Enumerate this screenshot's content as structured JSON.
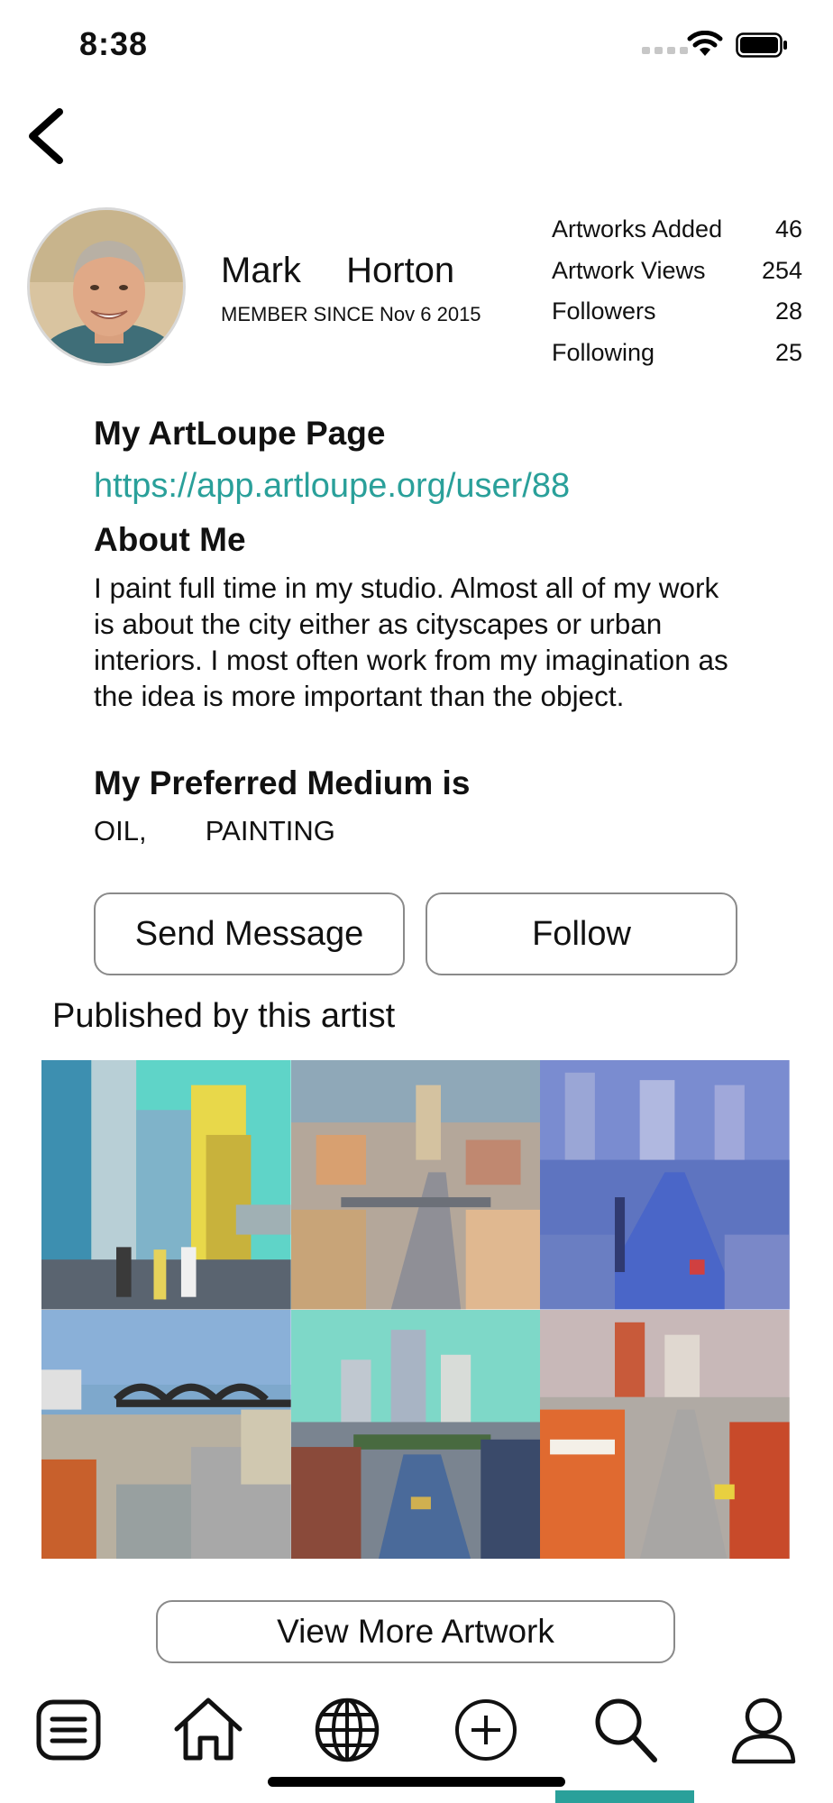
{
  "status_bar": {
    "time": "8:38"
  },
  "profile": {
    "first_name": "Mark",
    "last_name": "Horton",
    "full_name": "Mark  Horton",
    "member_since": "MEMBER SINCE Nov 6 2015"
  },
  "stats": [
    {
      "label": "Artworks Added",
      "value": "46"
    },
    {
      "label": "Artwork Views",
      "value": "254"
    },
    {
      "label": "Followers",
      "value": "28"
    },
    {
      "label": "Following",
      "value": "25"
    }
  ],
  "page_section": {
    "title": "My ArtLoupe Page",
    "url": "https://app.artloupe.org/user/88"
  },
  "about": {
    "title": "About Me",
    "text": "I paint full time in my studio. Almost all of my work is about the city either as cityscapes or urban interiors. I most often work from my imagination as the idea is more important than the object."
  },
  "medium": {
    "title": "My Preferred Medium is",
    "value": "OIL,  PAINTING"
  },
  "actions": {
    "send_message": "Send Message",
    "follow": "Follow"
  },
  "gallery": {
    "title": "Published by this artist",
    "artworks": [
      {
        "name": "artwork-1"
      },
      {
        "name": "artwork-2"
      },
      {
        "name": "artwork-3"
      },
      {
        "name": "artwork-4"
      },
      {
        "name": "artwork-5"
      },
      {
        "name": "artwork-6"
      }
    ],
    "view_more": "View More Artwork"
  },
  "tabbar": {
    "items": [
      {
        "icon": "menu-icon"
      },
      {
        "icon": "home-icon"
      },
      {
        "icon": "globe-icon"
      },
      {
        "icon": "add-icon"
      },
      {
        "icon": "search-icon"
      },
      {
        "icon": "profile-icon"
      }
    ]
  },
  "colors": {
    "accent": "#2aa09a"
  }
}
